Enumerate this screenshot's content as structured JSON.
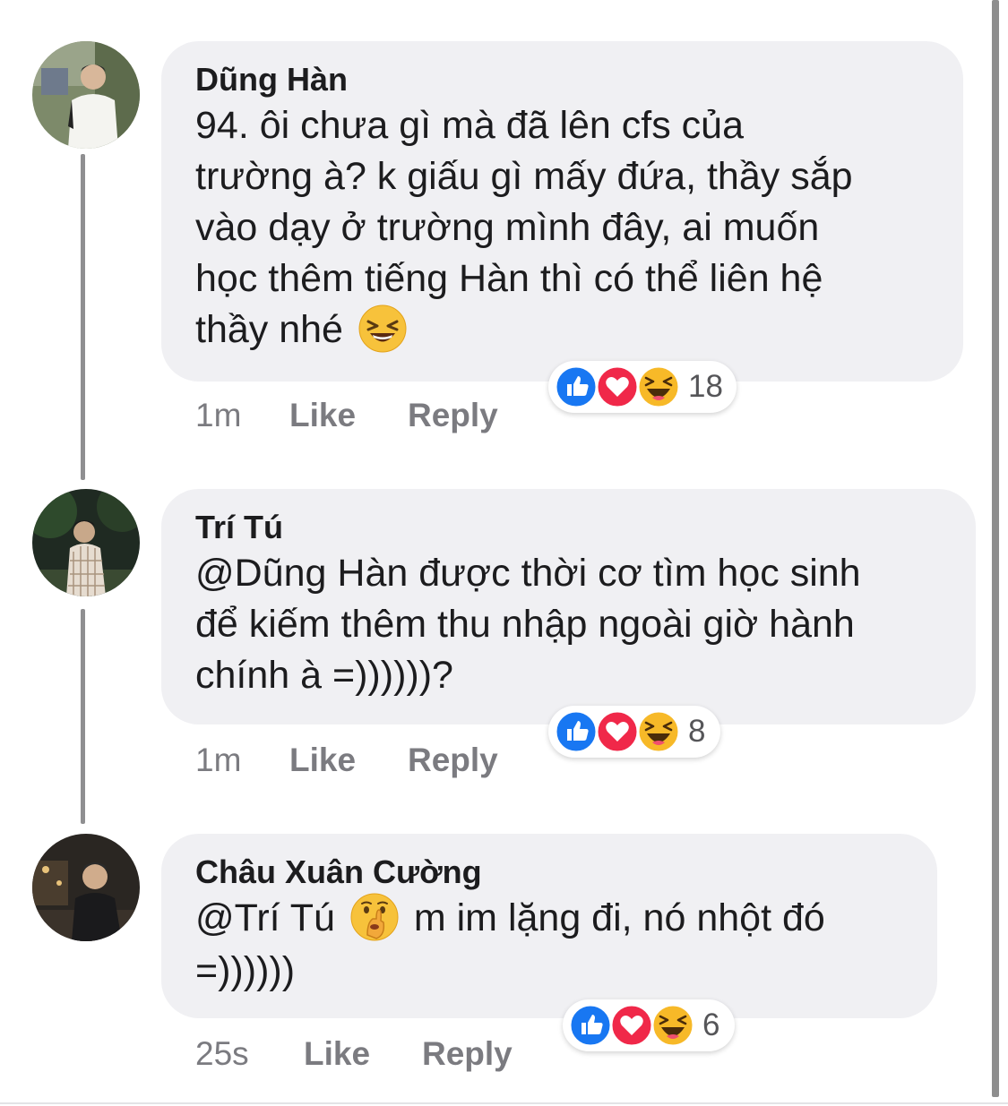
{
  "comments": [
    {
      "author": "Dũng Hàn",
      "text": "94. ôi chưa gì mà đã lên cfs của\ntrường à? k giấu gì mấy đứa, thầy sắp\nvào dạy ở trường mình đây, ai muốn\nhọc thêm tiếng Hàn thì có thể liên hệ\nthầy nhé",
      "trailing_emoji": "laughing-face",
      "time": "1m",
      "like_label": "Like",
      "reply_label": "Reply",
      "reaction_count": "18"
    },
    {
      "author": "Trí Tú",
      "mention": "@Dũng Hàn",
      "text": " được thời cơ tìm học sinh\nđể kiếm thêm thu nhập ngoài giờ hành\nchính à =))))))?",
      "time": "1m",
      "like_label": "Like",
      "reply_label": "Reply",
      "reaction_count": "8"
    },
    {
      "author": "Châu Xuân Cường",
      "mention": "@Trí Tú",
      "mid_emoji": "shushing-face",
      "text": " m im lặng đi, nó nhột đó\n=))))))",
      "time": "25s",
      "like_label": "Like",
      "reply_label": "Reply",
      "reaction_count": "6"
    }
  ],
  "reaction_icons": [
    "like-icon",
    "love-icon",
    "haha-icon"
  ],
  "colors": {
    "bubble": "#f0f0f3",
    "like_blue": "#1877f2",
    "love_red": "#f02849",
    "haha_yellow": "#f7b928",
    "meta_gray": "#7b7b80"
  }
}
